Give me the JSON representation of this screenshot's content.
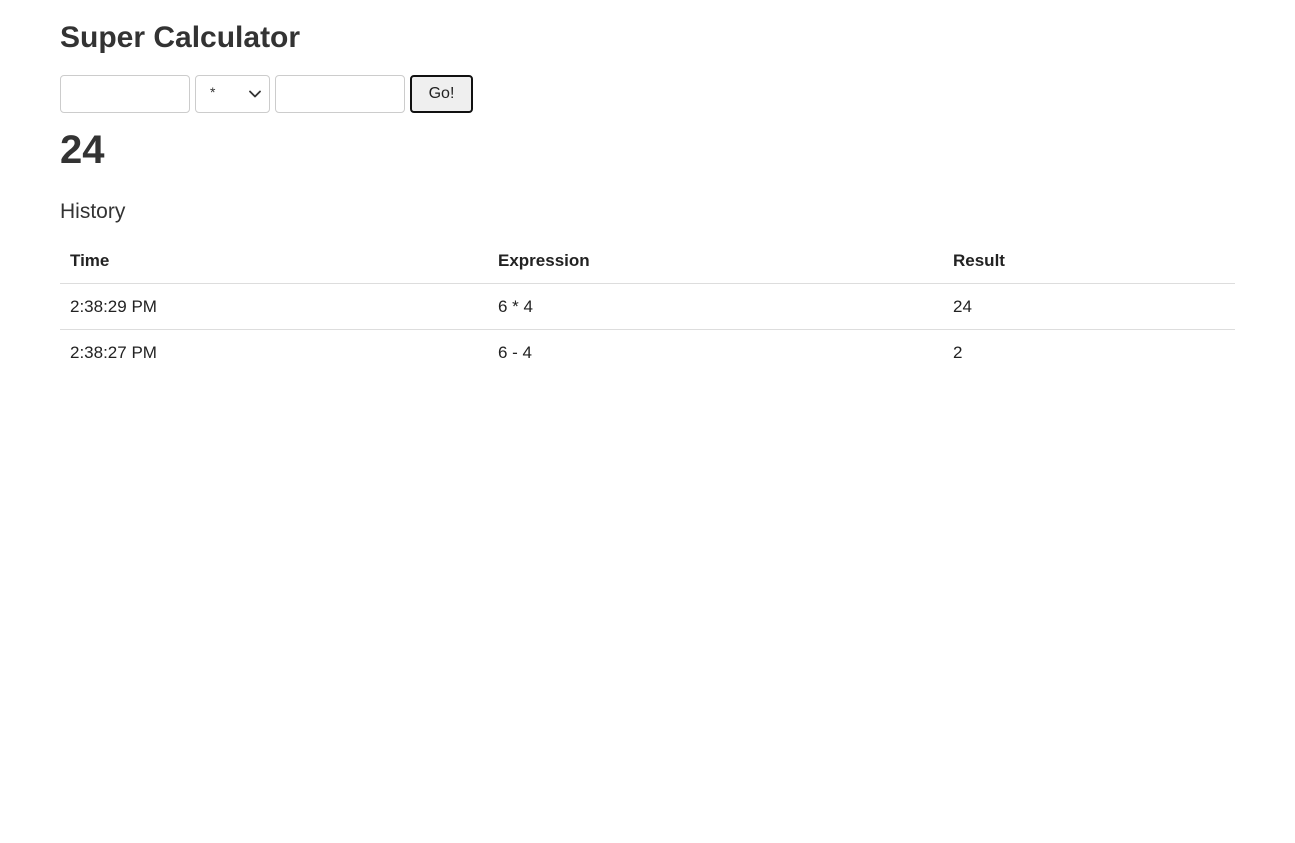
{
  "app": {
    "title": "Super Calculator"
  },
  "form": {
    "first_input": {
      "value": "",
      "placeholder": ""
    },
    "operator": {
      "selected": "*"
    },
    "second_input": {
      "value": "",
      "placeholder": ""
    },
    "go_label": "Go!"
  },
  "result": {
    "value": "24"
  },
  "history": {
    "heading": "History",
    "columns": {
      "time": "Time",
      "expression": "Expression",
      "result": "Result"
    },
    "rows": [
      {
        "time": "2:38:29 PM",
        "expression": "6 * 4",
        "result": "24"
      },
      {
        "time": "2:38:27 PM",
        "expression": "6 - 4",
        "result": "2"
      }
    ]
  },
  "icons": {
    "select_chevron": "chevron-down-icon"
  },
  "colors": {
    "text": "#333333",
    "border": "#cccccc",
    "button_bg": "#efefef",
    "row_divider": "#dddddd"
  }
}
